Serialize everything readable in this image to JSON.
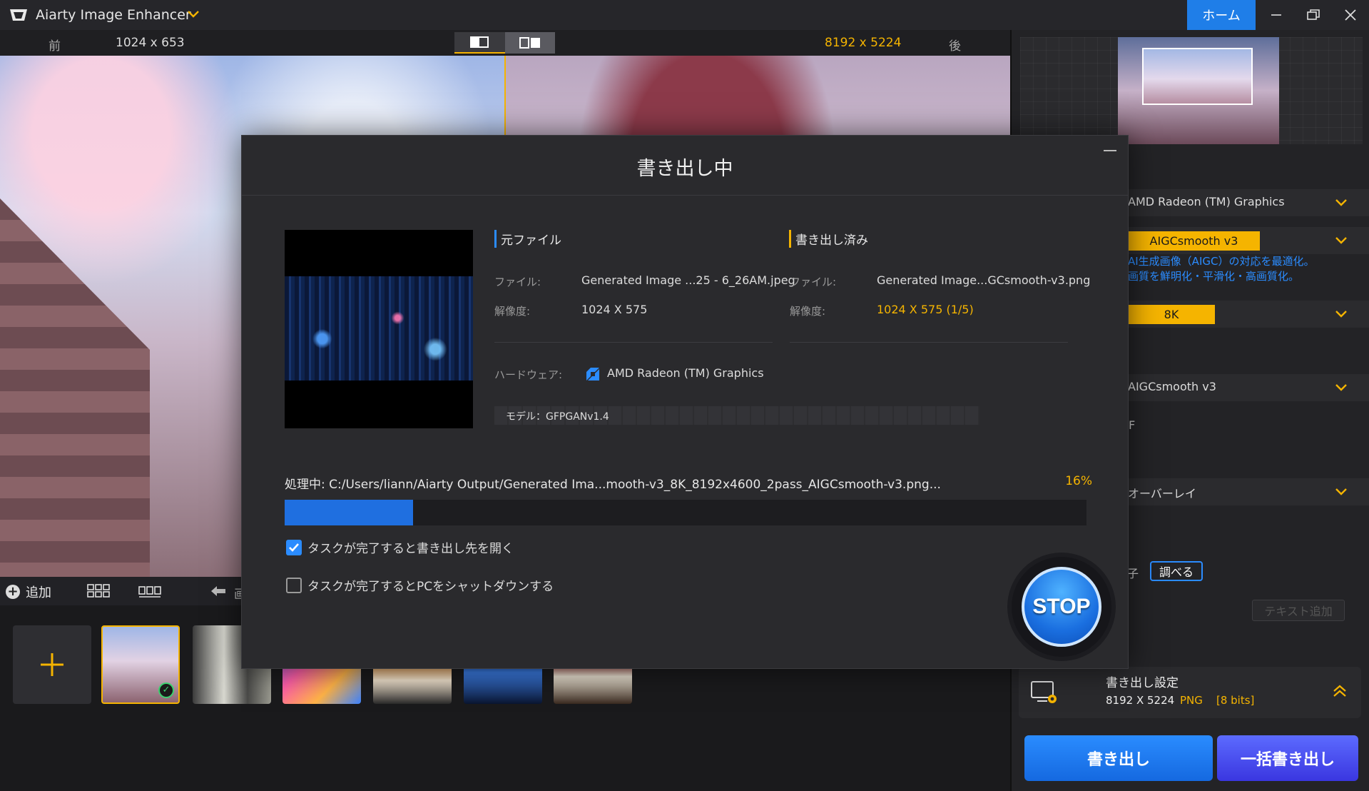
{
  "app": {
    "title": "Aiarty Image Enhancer",
    "home_label": "ホーム"
  },
  "compare": {
    "before_label": "前",
    "before_resolution": "1024 x 653",
    "after_resolution": "8192 x 5224",
    "after_label": "後"
  },
  "toolbar": {
    "add_label": "追加",
    "stub_label": "画"
  },
  "right_panel": {
    "gpu": "AMD Radeon (TM) Graphics",
    "model": "AIGCsmooth  v3",
    "model_desc_1": "AI生成画像（AIGC）の対応を最適化。",
    "model_desc_2": "画質を鮮明化・平滑化・高画質化。",
    "scale": "8K",
    "second_model": "AIGCsmooth  v3",
    "label_f": "F",
    "overlay": "オーバーレイ",
    "label_char": "子",
    "lookup_label": "調べる",
    "add_text_label": "テキスト追加",
    "export_settings_title": "書き出し設定",
    "export_res": "8192 X 5224",
    "export_format": "PNG",
    "export_bits": "[8 bits]",
    "export_label": "書き出し",
    "batch_export_label": "一括書き出し"
  },
  "dialog": {
    "title": "書き出し中",
    "source_header": "元ファイル",
    "output_header": "書き出し済み",
    "file_key": "ファイル:",
    "res_key": "解像度:",
    "source_file": "Generated Image ...25 - 6_26AM.jpeg",
    "source_res": "1024 X 575",
    "output_file": "Generated Image...GCsmooth-v3.png",
    "output_res": "1024 X 575 (1/5)",
    "hardware_key": "ハードウェア:",
    "hardware_value": "AMD Radeon (TM) Graphics",
    "model_line": "モデル：GFPGANv1.4",
    "processing_text": "処理中:  C:/Users/liann/Aiarty Output/Generated Ima...mooth-v3_8K_8192x4600_2pass_AIGCsmooth-v3.png...",
    "progress_label": "16%",
    "progress_value": 0.16,
    "open_folder_label": "タスクが完了すると書き出し先を開く",
    "open_folder_checked": true,
    "shutdown_label": "タスクが完了するとPCをシャットダウンする",
    "shutdown_checked": false,
    "stop_label": "STOP"
  },
  "colors": {
    "accent_blue": "#1f7ee8",
    "accent_orange": "#f5b400"
  }
}
